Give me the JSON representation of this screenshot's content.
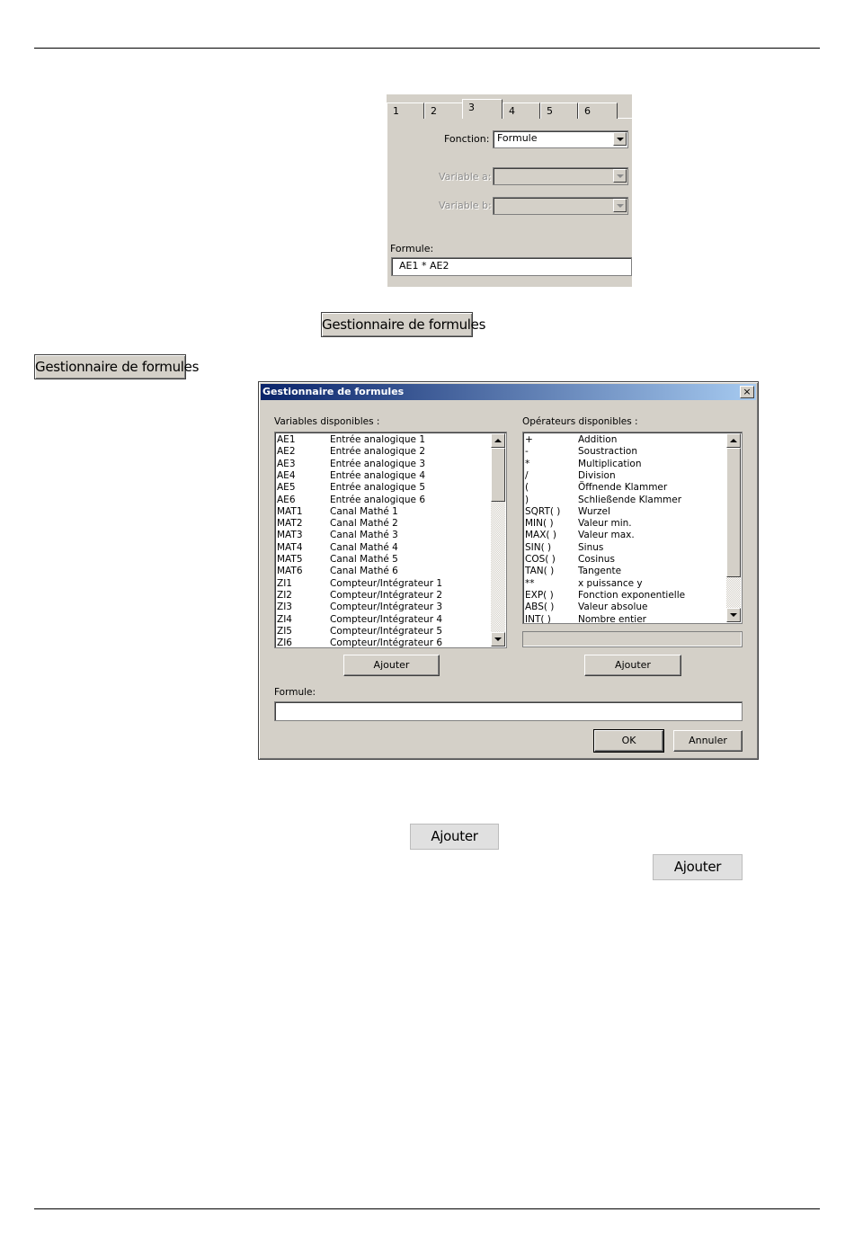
{
  "tab_panel": {
    "tabs": [
      "1",
      "2",
      "3",
      "4",
      "5",
      "6"
    ],
    "active_tab": "3",
    "fonction_label": "Fonction:",
    "fonction_value": "Formule",
    "variable_a_label": "Variable a:",
    "variable_b_label": "Variable b:",
    "formule_label": "Formule:",
    "formule_value": "AE1 * AE2"
  },
  "buttons": {
    "gestionnaire_1": "Gestionnaire de formules",
    "gestionnaire_2": "Gestionnaire de formules",
    "ajouter_1": "Ajouter",
    "ajouter_2": "Ajouter"
  },
  "dialog": {
    "title": "Gestionnaire de formules",
    "close": "×",
    "variables_label": "Variables disponibles :",
    "operators_label": "Opérateurs disponibles :",
    "variables": [
      {
        "code": "AE1",
        "desc": "Entrée analogique 1"
      },
      {
        "code": "AE2",
        "desc": "Entrée analogique 2"
      },
      {
        "code": "AE3",
        "desc": "Entrée analogique 3"
      },
      {
        "code": "AE4",
        "desc": "Entrée analogique 4"
      },
      {
        "code": "AE5",
        "desc": "Entrée analogique 5"
      },
      {
        "code": "AE6",
        "desc": "Entrée analogique 6"
      },
      {
        "code": "MAT1",
        "desc": "Canal Mathé 1"
      },
      {
        "code": "MAT2",
        "desc": "Canal Mathé 2"
      },
      {
        "code": "MAT3",
        "desc": "Canal Mathé 3"
      },
      {
        "code": "MAT4",
        "desc": "Canal Mathé 4"
      },
      {
        "code": "MAT5",
        "desc": "Canal Mathé 5"
      },
      {
        "code": "MAT6",
        "desc": "Canal Mathé 6"
      },
      {
        "code": "ZI1",
        "desc": "Compteur/Intégrateur 1"
      },
      {
        "code": "ZI2",
        "desc": "Compteur/Intégrateur 2"
      },
      {
        "code": "ZI3",
        "desc": "Compteur/Intégrateur 3"
      },
      {
        "code": "ZI4",
        "desc": "Compteur/Intégrateur 4"
      },
      {
        "code": "ZI5",
        "desc": "Compteur/Intégrateur 5"
      },
      {
        "code": "ZI6",
        "desc": "Compteur/Intégrateur 6"
      }
    ],
    "operators": [
      {
        "code": "+",
        "desc": "Addition"
      },
      {
        "code": "-",
        "desc": "Soustraction"
      },
      {
        "code": "*",
        "desc": "Multiplication"
      },
      {
        "code": "/",
        "desc": "Division"
      },
      {
        "code": "(",
        "desc": "Öffnende Klammer"
      },
      {
        "code": ")",
        "desc": "Schließende Klammer"
      },
      {
        "code": "SQRT( )",
        "desc": "Wurzel"
      },
      {
        "code": "MIN( )",
        "desc": "Valeur min."
      },
      {
        "code": "MAX( )",
        "desc": "Valeur max."
      },
      {
        "code": "SIN( )",
        "desc": "Sinus"
      },
      {
        "code": "COS( )",
        "desc": "Cosinus"
      },
      {
        "code": "TAN( )",
        "desc": "Tangente"
      },
      {
        "code": "**",
        "desc": "x puissance y"
      },
      {
        "code": "EXP( )",
        "desc": "Fonction exponentielle"
      },
      {
        "code": "ABS( )",
        "desc": "Valeur absolue"
      },
      {
        "code": "INT( )",
        "desc": "Nombre entier"
      }
    ],
    "ajouter_left": "Ajouter",
    "ajouter_right": "Ajouter",
    "formule_label": "Formule:",
    "formule_value": "",
    "ok": "OK",
    "annuler": "Annuler"
  }
}
